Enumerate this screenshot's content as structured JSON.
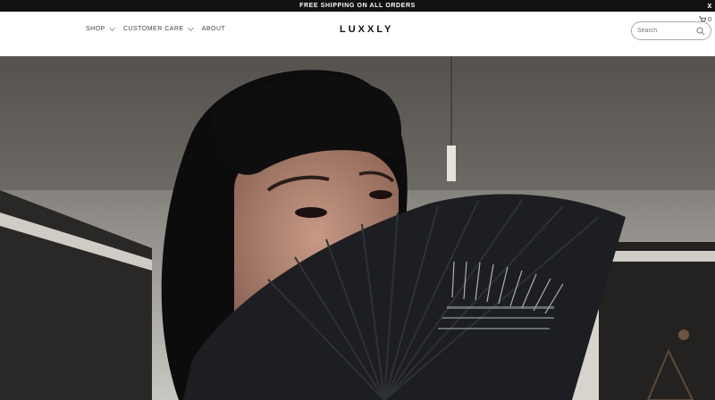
{
  "announcement": {
    "text": "FREE SHIPPING ON ALL ORDERS",
    "close": "x"
  },
  "header": {
    "logo": "LUXXLY",
    "nav": [
      {
        "label": "SHOP",
        "has_dropdown": true
      },
      {
        "label": "CUSTOMER CARE",
        "has_dropdown": true
      },
      {
        "label": "ABOUT",
        "has_dropdown": false
      }
    ],
    "cart_count": "0",
    "search_placeholder": "Search"
  },
  "colors": {
    "announcement_bg": "#111111",
    "text": "#444444"
  },
  "icons": [
    "cart-icon",
    "search-icon",
    "chevron-down-icon",
    "close-icon"
  ],
  "hero": {
    "image": "woman with black bangs holding a black folding fan covering lower face"
  }
}
